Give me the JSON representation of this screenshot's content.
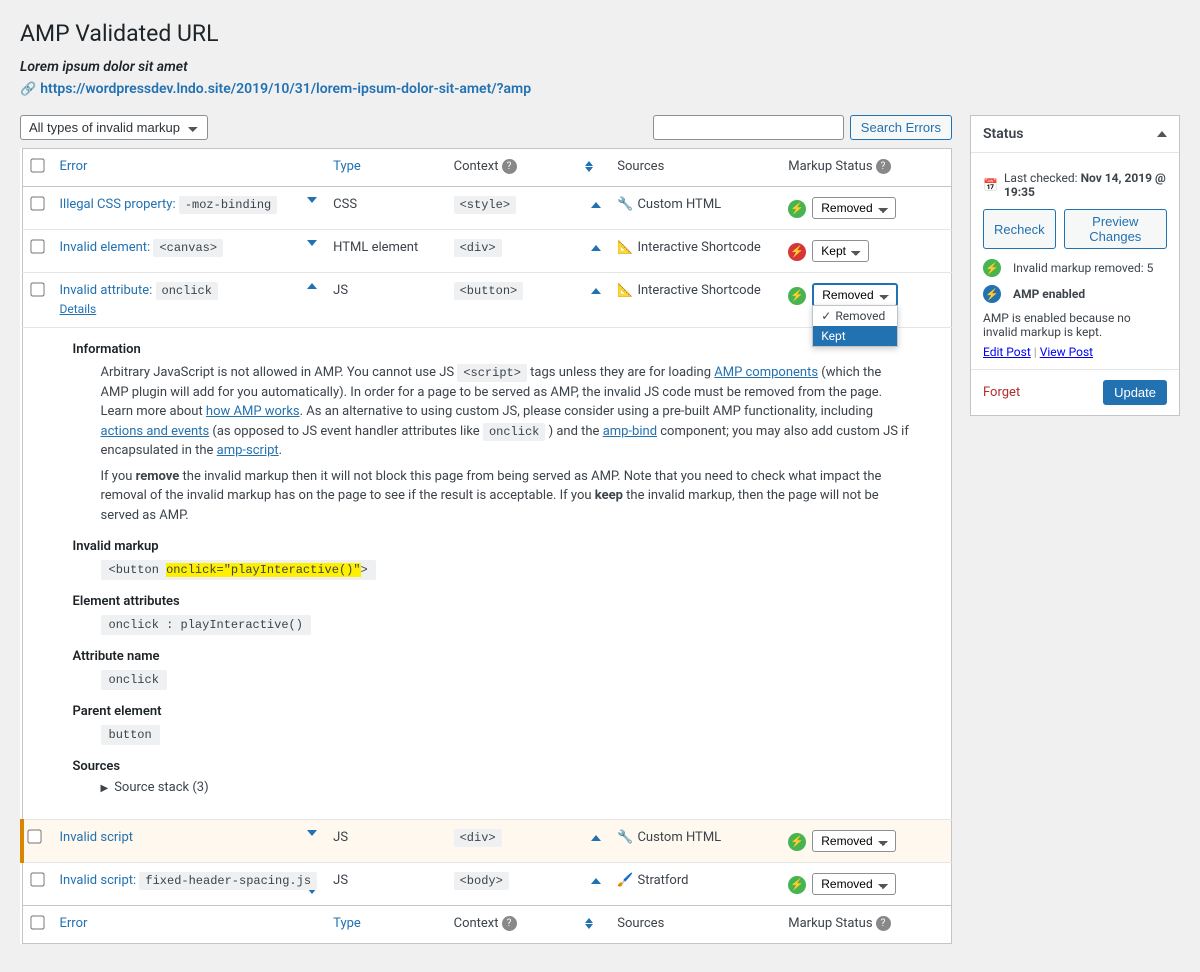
{
  "page_title": "AMP Validated URL",
  "post_title": "Lorem ipsum dolor sit amet",
  "validated_url": "https://wordpressdev.lndo.site/2019/10/31/lorem-ipsum-dolor-sit-amet/?amp",
  "filter_select": "All types of invalid markup",
  "search_button": "Search Errors",
  "columns": {
    "error": "Error",
    "type": "Type",
    "context": "Context",
    "sources": "Sources",
    "status": "Markup Status"
  },
  "status_options": {
    "removed": "Removed",
    "kept": "Kept"
  },
  "rows": [
    {
      "title_prefix": "Illegal CSS property:",
      "title_code": "-moz-binding",
      "type": "CSS",
      "context_code": "<style>",
      "source": "Custom HTML",
      "source_icon": "html",
      "status_value": "Removed",
      "status_color": "green",
      "expanded": false,
      "new": false,
      "open": false
    },
    {
      "title_prefix": "Invalid element:",
      "title_code": "<canvas>",
      "type": "HTML element",
      "context_code": "<div>",
      "source": "Interactive Shortcode",
      "source_icon": "slash",
      "status_value": "Kept",
      "status_color": "red",
      "expanded": false,
      "new": false,
      "open": false
    },
    {
      "title_prefix": "Invalid attribute:",
      "title_code": "onclick",
      "type": "JS",
      "context_code": "<button>",
      "source": "Interactive Shortcode",
      "source_icon": "slash",
      "status_value": "Removed",
      "status_color": "green",
      "expanded": true,
      "new": false,
      "open": true,
      "details_label": "Details"
    },
    {
      "title_prefix": "Invalid script",
      "title_code": "",
      "type": "JS",
      "context_code": "<div>",
      "source": "Custom HTML",
      "source_icon": "html",
      "status_value": "Removed",
      "status_color": "green",
      "expanded": false,
      "new": true,
      "open": false
    },
    {
      "title_prefix": "Invalid script:",
      "title_code": "fixed-header-spacing.js",
      "type": "JS",
      "context_code": "<body>",
      "source": "Stratford",
      "source_icon": "brush",
      "status_value": "Removed",
      "status_color": "green",
      "expanded": false,
      "new": false,
      "open": false
    }
  ],
  "details": {
    "info_h": "Information",
    "info_p1a": "Arbitrary JavaScript is not allowed in AMP. You cannot use JS ",
    "info_p1_code1": "<script>",
    "info_p1b": " tags unless they are for loading ",
    "link_amp_components": "AMP components",
    "info_p1c": " (which the AMP plugin will add for you automatically). In order for a page to be served as AMP, the invalid JS code must be removed from the page. Learn more about ",
    "link_how_amp_works": "how AMP works",
    "info_p1d": ". As an alternative to using custom JS, please consider using a pre-built AMP functionality, including ",
    "link_actions": "actions and events",
    "info_p1e": " (as opposed to JS event handler attributes like ",
    "info_p1_code2": "onclick",
    "info_p1f": " ) and the ",
    "link_amp_bind": "amp-bind",
    "info_p1g": " component; you may also add custom JS if encapsulated in the ",
    "link_amp_script": "amp-script",
    "info_p1h": ".",
    "info_p2a": "If you ",
    "bold_remove": "remove",
    "info_p2b": " the invalid markup then it will not block this page from being served as AMP. Note that you need to check what impact the removal of the invalid markup has on the page to see if the result is acceptable. If you ",
    "bold_keep": "keep",
    "info_p2c": " the invalid markup, then the page will not be served as AMP.",
    "invalid_markup_h": "Invalid markup",
    "invalid_markup_pre": "<button ",
    "invalid_markup_hl": "onclick=\"playInteractive()\"",
    "invalid_markup_post": ">",
    "elem_attr_h": "Element attributes",
    "elem_attr_val": "onclick : playInteractive()",
    "attr_name_h": "Attribute name",
    "attr_name_val": "onclick",
    "parent_h": "Parent element",
    "parent_val": "button",
    "sources_h": "Sources",
    "source_stack": "Source stack (3)"
  },
  "sidebar": {
    "status_h": "Status",
    "last_checked_label": "Last checked: ",
    "last_checked_val": "Nov 14, 2019 @ 19:35",
    "recheck": "Recheck",
    "preview": "Preview Changes",
    "removed_count": "Invalid markup removed: 5",
    "amp_enabled": "AMP enabled",
    "amp_reason": "AMP is enabled because no invalid markup is kept.",
    "edit_post": "Edit Post",
    "view_post": "View Post",
    "forget": "Forget",
    "update": "Update"
  }
}
